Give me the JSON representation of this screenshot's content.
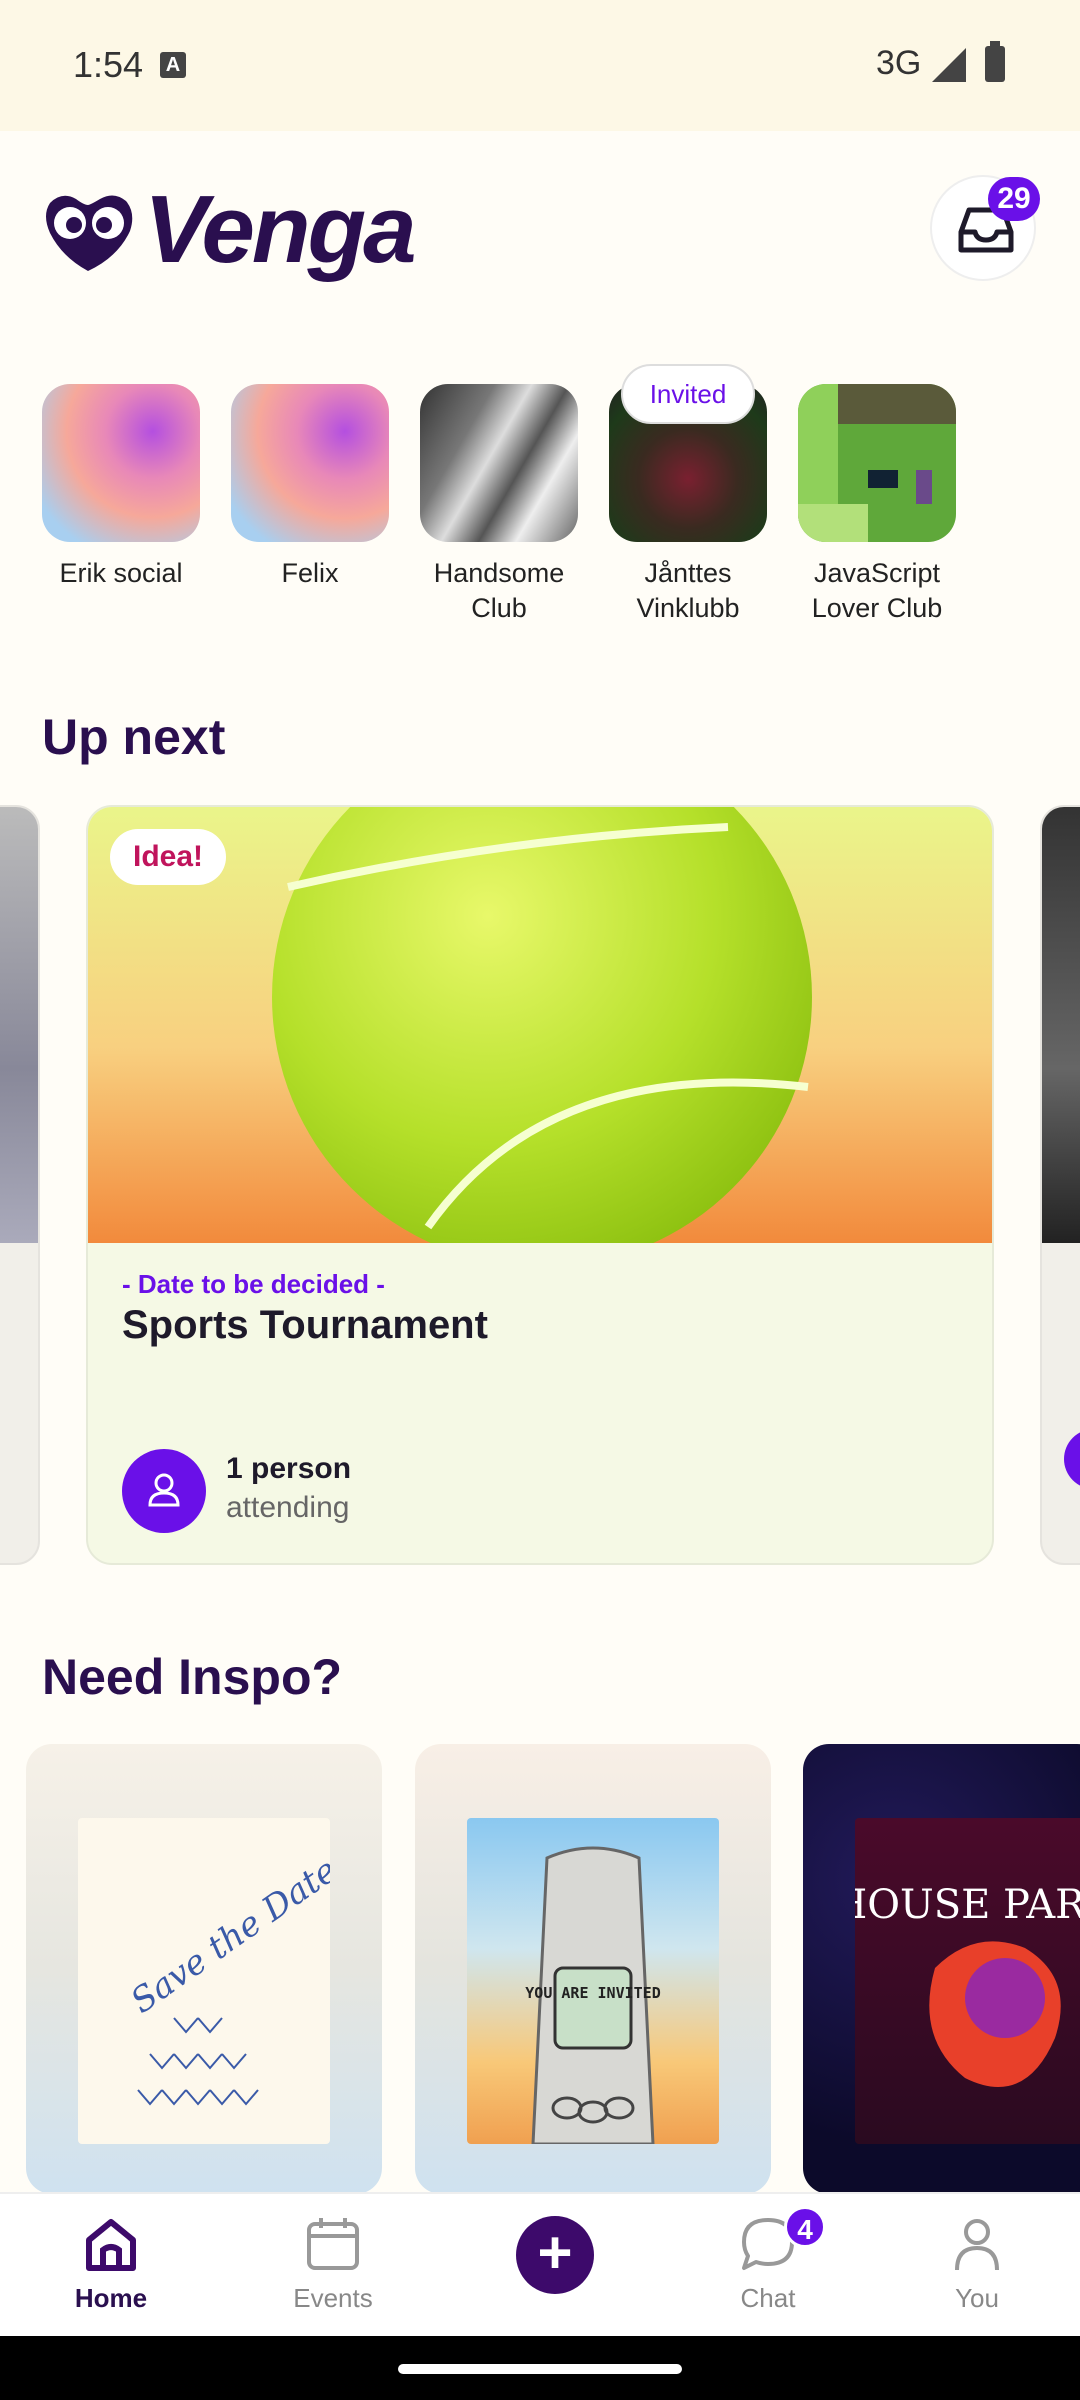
{
  "status_bar": {
    "time": "1:54",
    "network": "3G"
  },
  "header": {
    "app_name": "Venga",
    "inbox_count": "29"
  },
  "groups": [
    {
      "label": "Erik social"
    },
    {
      "label": "Felix"
    },
    {
      "label": "Handsome Club"
    },
    {
      "label": "Jånttes Vinklubb",
      "badge": "Invited"
    },
    {
      "label": "JavaScript Lover Club"
    }
  ],
  "up_next": {
    "title": "Up next",
    "card": {
      "tag": "Idea!",
      "date": "- Date to be decided -",
      "name": "Sports Tournament",
      "attendees": "1 person",
      "attendees_sub": "attending"
    }
  },
  "inspo": {
    "title": "Need Inspo?",
    "cards": [
      {
        "text": "Save the Date"
      },
      {
        "text": "YOU ARE INVITED"
      },
      {
        "text": "HOUSE PARTY"
      }
    ]
  },
  "nav": {
    "home": "Home",
    "events": "Events",
    "chat": "Chat",
    "chat_badge": "4",
    "you": "You"
  },
  "colors": {
    "accent": "#6a10e8",
    "brand": "#2a0f4f",
    "idea": "#c0145c"
  }
}
